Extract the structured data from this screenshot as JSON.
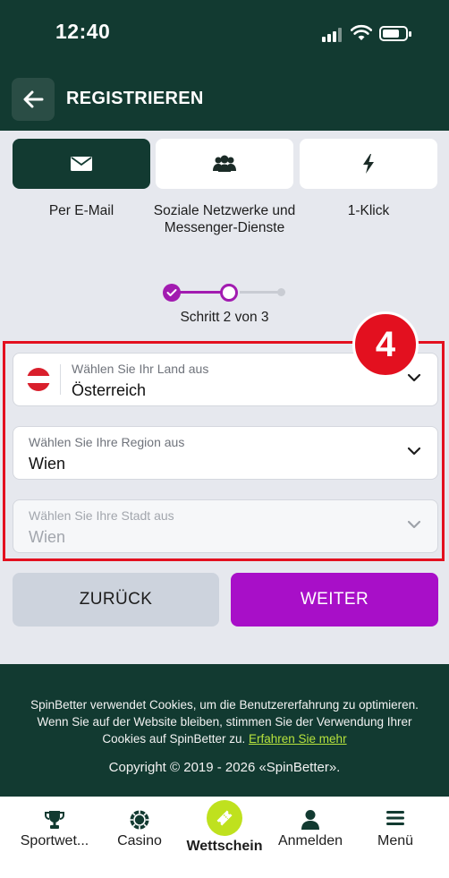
{
  "status_bar": {
    "time": "12:40"
  },
  "header": {
    "title": "REGISTRIEREN"
  },
  "methods": [
    {
      "label": "Per E-Mail",
      "icon": "envelope-icon",
      "active": true
    },
    {
      "label": "Soziale Netzwerke und Messenger-Dienste",
      "icon": "users-icon",
      "active": false
    },
    {
      "label": "1-Klick",
      "icon": "lightning-icon",
      "active": false
    }
  ],
  "stepper": {
    "text": "Schritt 2 von 3",
    "current": 2,
    "total": 3
  },
  "annotation": {
    "badge": "4",
    "color": "#e3101f"
  },
  "form": {
    "country": {
      "label": "Wählen Sie Ihr Land aus",
      "value": "Österreich",
      "flag": "austria-flag"
    },
    "region": {
      "label": "Wählen Sie Ihre Region aus",
      "value": "Wien"
    },
    "city": {
      "label": "Wählen Sie Ihre Stadt aus",
      "value": "Wien",
      "disabled": true
    }
  },
  "buttons": {
    "back": "ZURÜCK",
    "next": "WEITER"
  },
  "footer": {
    "cookie_text": "SpinBetter verwendet Cookies, um die Benutzererfahrung zu optimieren. Wenn Sie auf der Website bleiben, stimmen Sie der Verwendung Ihrer Cookies auf SpinBetter zu.",
    "cookie_link": "Erfahren Sie mehr",
    "copyright": "Copyright © 2019 - 2026 «SpinBetter»."
  },
  "bottom_nav": [
    {
      "label": "Sportwet...",
      "icon": "trophy-icon"
    },
    {
      "label": "Casino",
      "icon": "chip-icon"
    },
    {
      "label": "Wettschein",
      "icon": "ticket-icon",
      "active": true
    },
    {
      "label": "Anmelden",
      "icon": "user-icon"
    },
    {
      "label": "Menü",
      "icon": "menu-icon"
    }
  ],
  "colors": {
    "brand_dark": "#123a31",
    "accent_purple": "#a80fc8",
    "accent_lime": "#bfe11e",
    "background": "#e6e8ee"
  }
}
